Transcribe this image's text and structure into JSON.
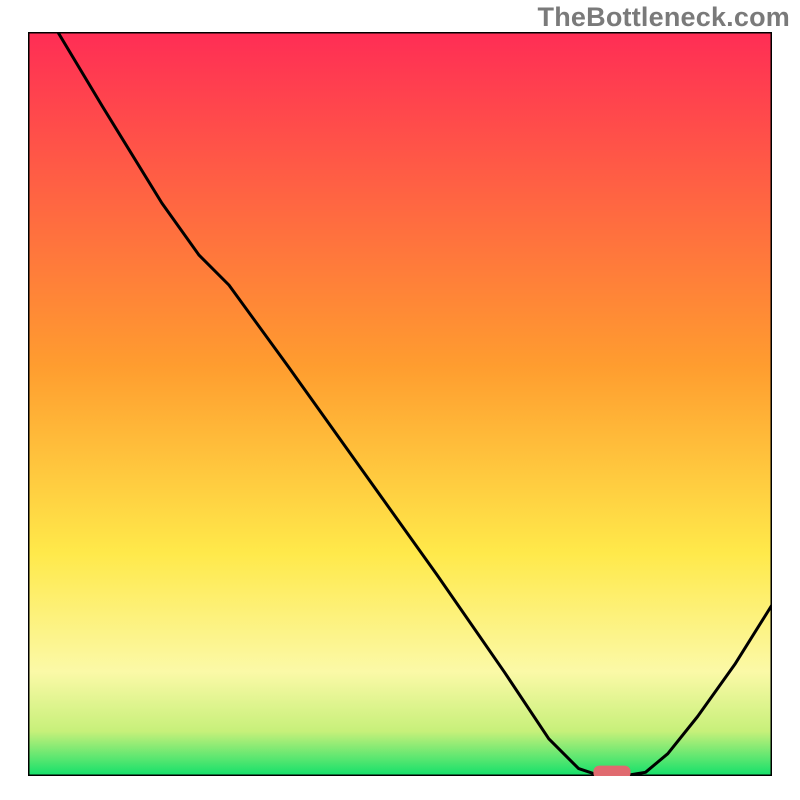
{
  "watermark": "TheBottleneck.com",
  "chart_data": {
    "type": "line",
    "title": "",
    "xlabel": "",
    "ylabel": "",
    "xlim": [
      0,
      100
    ],
    "ylim": [
      0,
      100
    ],
    "grid": false,
    "background_gradient": {
      "stops": [
        {
          "offset": 0.0,
          "color": "#ff2d55"
        },
        {
          "offset": 0.45,
          "color": "#ff9d2f"
        },
        {
          "offset": 0.7,
          "color": "#ffe94a"
        },
        {
          "offset": 0.86,
          "color": "#fbf9a7"
        },
        {
          "offset": 0.94,
          "color": "#c7f07a"
        },
        {
          "offset": 1.0,
          "color": "#12e06a"
        }
      ]
    },
    "series": [
      {
        "name": "bottleneck-curve",
        "type": "line",
        "color": "#000000",
        "x": [
          4,
          10,
          18,
          23,
          27,
          35,
          45,
          55,
          64,
          70,
          74,
          77,
          80,
          83,
          86,
          90,
          95,
          100
        ],
        "y": [
          100,
          90,
          77,
          70,
          66,
          55,
          41,
          27,
          14,
          5,
          1,
          0,
          0,
          0.5,
          3,
          8,
          15,
          23
        ]
      }
    ],
    "marker": {
      "name": "optimal-marker",
      "x": 78.5,
      "y": 0.5,
      "width": 5,
      "height": 1.8,
      "color": "#e06a6f"
    }
  }
}
